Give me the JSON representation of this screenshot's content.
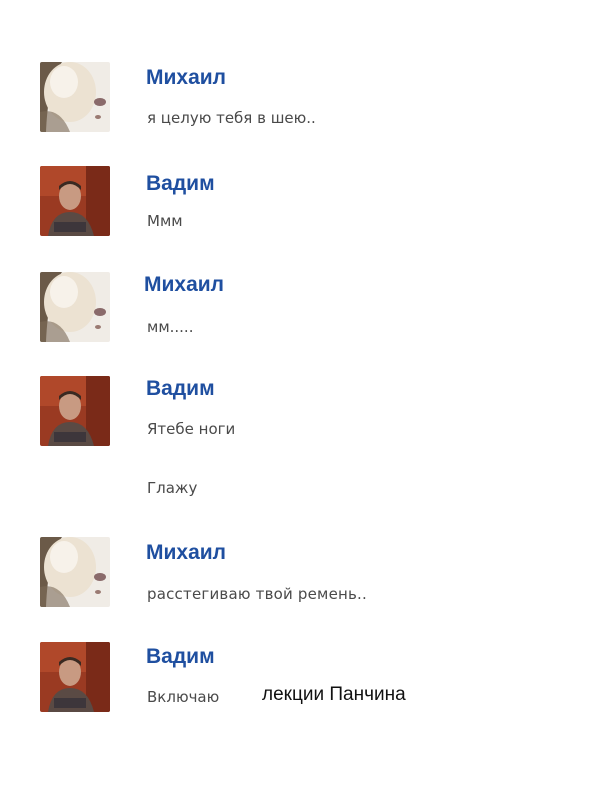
{
  "messages": [
    {
      "sender": "Михаил",
      "avatar": "blonde-avatar",
      "lines": [
        "я целую тебя в шею.."
      ]
    },
    {
      "sender": "Вадим",
      "avatar": "male-avatar",
      "lines": [
        "Ммм"
      ]
    },
    {
      "sender": "Михаил",
      "avatar": "blonde-avatar",
      "lines": [
        "мм....."
      ]
    },
    {
      "sender": "Вадим",
      "avatar": "male-avatar",
      "lines": [
        "Ятебе ноги",
        "Глажу"
      ]
    },
    {
      "sender": "Михаил",
      "avatar": "blonde-avatar",
      "lines": [
        "расстегиваю твой ремень.."
      ]
    },
    {
      "sender": "Вадим",
      "avatar": "male-avatar",
      "lines": [
        "Включаю"
      ],
      "overlay_text": "лекции Панчина"
    }
  ],
  "colors": {
    "sender_name": "#1f4fa0",
    "message_text": "#4a4a4a",
    "overlay_text": "#111111",
    "background": "#ffffff"
  }
}
